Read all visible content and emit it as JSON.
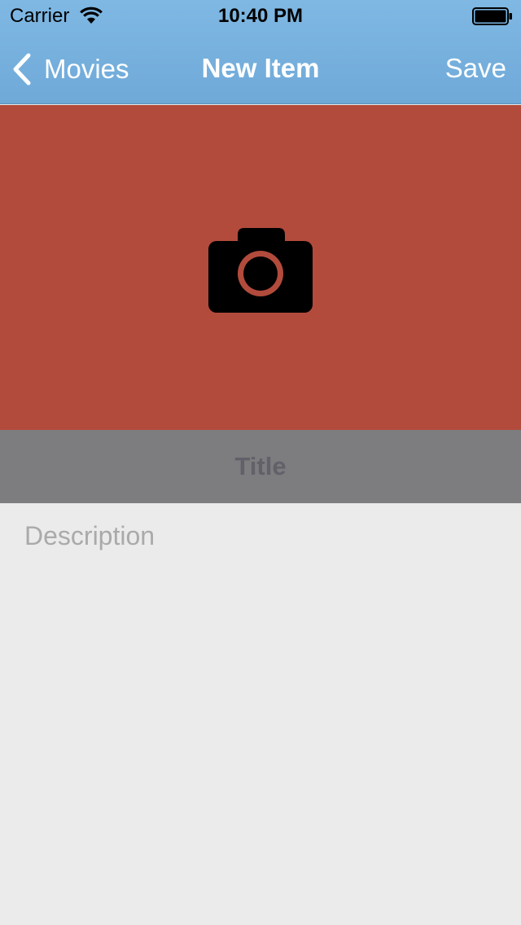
{
  "status_bar": {
    "carrier": "Carrier",
    "time": "10:40 PM",
    "wifi_icon": "wifi-icon",
    "battery_icon": "battery-full-icon"
  },
  "nav_bar": {
    "back_label": "Movies",
    "back_icon": "chevron-left-icon",
    "title": "New Item",
    "save_label": "Save",
    "background_color": "#74afdd"
  },
  "photo_area": {
    "icon": "camera-icon",
    "background_color": "#b24b3c"
  },
  "form": {
    "title_placeholder": "Title",
    "title_value": "",
    "title_background_color": "#7d7c7f",
    "description_placeholder": "Description",
    "description_value": ""
  }
}
